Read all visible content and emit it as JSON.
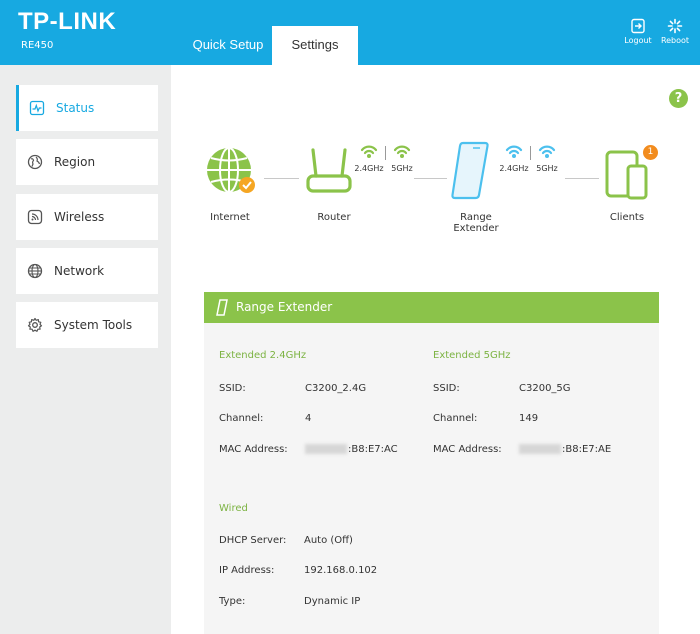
{
  "header": {
    "brand": "TP-LINK",
    "model": "RE450",
    "tabs": [
      "Quick Setup",
      "Settings"
    ],
    "logout_label": "Logout",
    "reboot_label": "Reboot",
    "bg_color": "#17a9e1"
  },
  "sidebar": {
    "items": [
      {
        "label": "Status",
        "icon": "status-icon",
        "active": true
      },
      {
        "label": "Region",
        "icon": "globe-icon"
      },
      {
        "label": "Wireless",
        "icon": "wireless-icon"
      },
      {
        "label": "Network",
        "icon": "network-icon"
      },
      {
        "label": "System Tools",
        "icon": "gear-icon"
      }
    ]
  },
  "help_label": "?",
  "topology": {
    "internet": "Internet",
    "router": "Router",
    "range_extender": "Range Extender",
    "clients": "Clients",
    "clients_count": "1",
    "band_24": "2.4GHz",
    "band_5": "5GHz"
  },
  "panel": {
    "title": "Range Extender",
    "accent_color": "#8bc34a",
    "ext24": {
      "heading": "Extended 2.4GHz",
      "ssid_label": "SSID:",
      "ssid": "C3200_2.4G",
      "channel_label": "Channel:",
      "channel": "4",
      "mac_label": "MAC Address:",
      "mac": ":B8:E7:AC"
    },
    "ext5": {
      "heading": "Extended 5GHz",
      "ssid_label": "SSID:",
      "ssid": "C3200_5G",
      "channel_label": "Channel:",
      "channel": "149",
      "mac_label": "MAC Address:",
      "mac": ":B8:E7:AE"
    },
    "wired": {
      "heading": "Wired",
      "dhcp_label": "DHCP Server:",
      "dhcp": "Auto (Off)",
      "ip_label": "IP Address:",
      "ip": "192.168.0.102",
      "type_label": "Type:",
      "type": "Dynamic IP"
    }
  }
}
